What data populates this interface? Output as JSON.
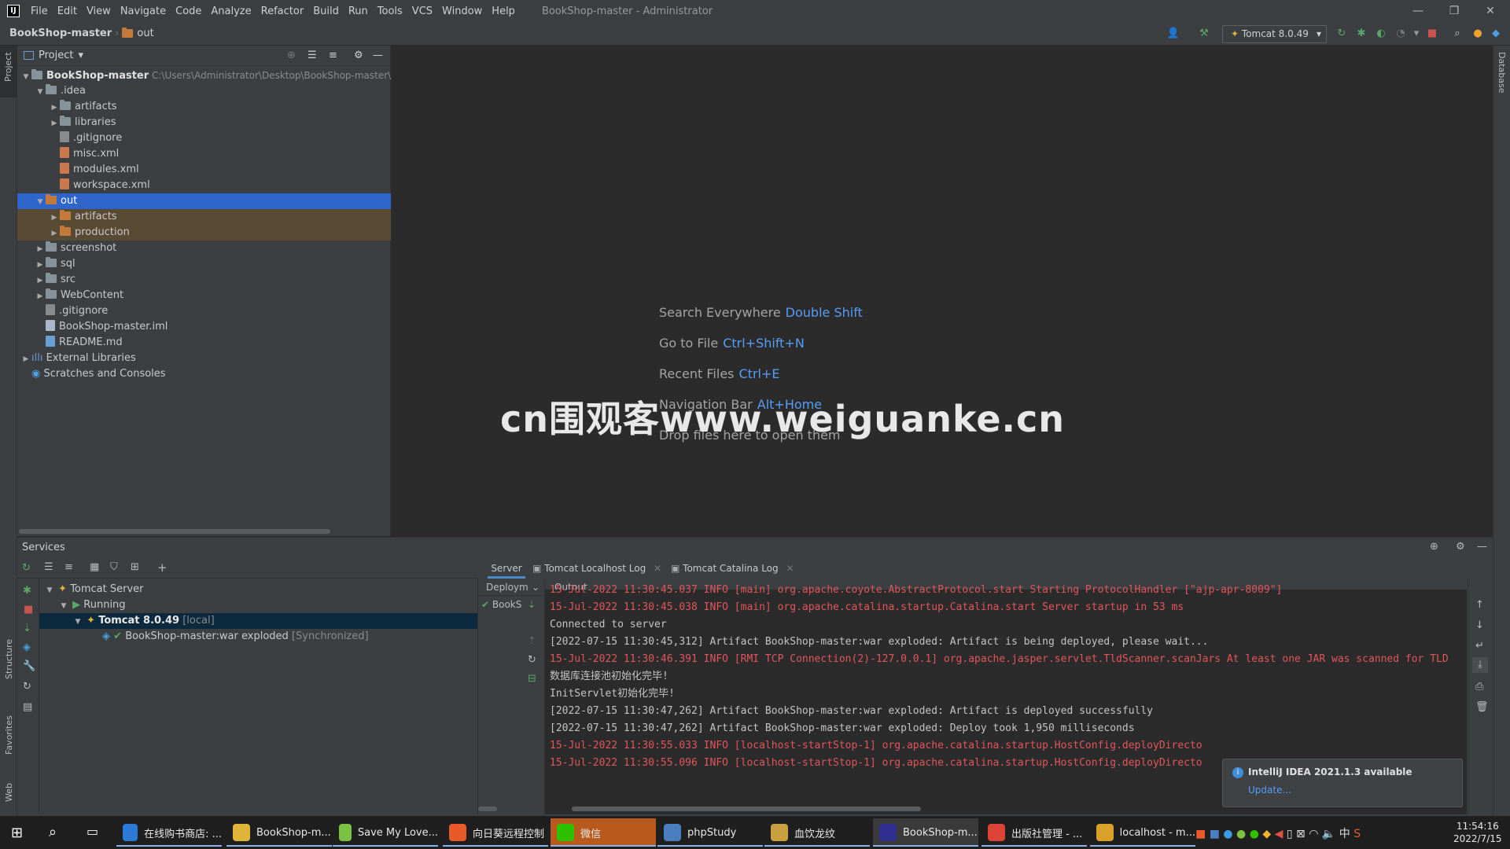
{
  "menubar": {
    "items": [
      "File",
      "Edit",
      "View",
      "Navigate",
      "Code",
      "Analyze",
      "Refactor",
      "Build",
      "Run",
      "Tools",
      "VCS",
      "Window",
      "Help"
    ],
    "title": "BookShop-master - Administrator"
  },
  "navbar": {
    "project": "BookShop-master",
    "folder": "out"
  },
  "toolbar": {
    "run_config": "Tomcat 8.0.49"
  },
  "side_labels": {
    "project": "Project",
    "structure": "Structure",
    "favorites": "Favorites",
    "web": "Web",
    "database": "Database"
  },
  "project_panel": {
    "title": "Project",
    "tree": [
      {
        "label": "BookShop-master",
        "path": "C:\\Users\\Administrator\\Desktop\\BookShop-master\\Bo",
        "indent": 0,
        "expanded": true,
        "type": "module"
      },
      {
        "label": ".idea",
        "indent": 1,
        "expanded": true,
        "type": "folder"
      },
      {
        "label": "artifacts",
        "indent": 2,
        "expanded": false,
        "type": "folder"
      },
      {
        "label": "libraries",
        "indent": 2,
        "expanded": false,
        "type": "folder"
      },
      {
        "label": ".gitignore",
        "indent": 2,
        "type": "git"
      },
      {
        "label": "misc.xml",
        "indent": 2,
        "type": "xml"
      },
      {
        "label": "modules.xml",
        "indent": 2,
        "type": "xml"
      },
      {
        "label": "workspace.xml",
        "indent": 2,
        "type": "xml"
      },
      {
        "label": "out",
        "indent": 1,
        "expanded": true,
        "type": "folder-orange",
        "selected": true
      },
      {
        "label": "artifacts",
        "indent": 2,
        "expanded": false,
        "type": "folder-orange",
        "highlight": true
      },
      {
        "label": "production",
        "indent": 2,
        "expanded": false,
        "type": "folder-orange",
        "highlight": true
      },
      {
        "label": "screenshot",
        "indent": 1,
        "expanded": false,
        "type": "folder"
      },
      {
        "label": "sql",
        "indent": 1,
        "expanded": false,
        "type": "folder"
      },
      {
        "label": "src",
        "indent": 1,
        "expanded": false,
        "type": "folder"
      },
      {
        "label": "WebContent",
        "indent": 1,
        "expanded": false,
        "type": "folder"
      },
      {
        "label": ".gitignore",
        "indent": 1,
        "type": "git"
      },
      {
        "label": "BookShop-master.iml",
        "indent": 1,
        "type": "file"
      },
      {
        "label": "README.md",
        "indent": 1,
        "type": "md"
      },
      {
        "label": "External Libraries",
        "indent": 0,
        "expanded": false,
        "type": "lib"
      },
      {
        "label": "Scratches and Consoles",
        "indent": 0,
        "type": "scratch"
      }
    ]
  },
  "editor_hints": [
    {
      "label": "Search Everywhere",
      "key": "Double Shift"
    },
    {
      "label": "Go to File",
      "key": "Ctrl+Shift+N"
    },
    {
      "label": "Recent Files",
      "key": "Ctrl+E"
    },
    {
      "label": "Navigation Bar",
      "key": "Alt+Home"
    },
    {
      "label": "Drop files here to open them",
      "key": ""
    }
  ],
  "watermark": "cn围观客www.weiguanke.cn",
  "services": {
    "title": "Services",
    "tree": [
      {
        "label": "Tomcat Server",
        "extra": ""
      },
      {
        "label": "Running",
        "extra": ""
      },
      {
        "label": "Tomcat 8.0.49",
        "extra": "[local]"
      },
      {
        "label": "BookShop-master:war exploded",
        "extra": "[Synchronized]"
      }
    ],
    "tabs": {
      "server": "Server",
      "localhost_log": "Tomcat Localhost Log",
      "catalina_log": "Tomcat Catalina Log"
    },
    "deploy_header": "Deploym",
    "deploy_item": "BookS",
    "output_header": "Output",
    "log_lines": [
      {
        "text": "15-Jul-2022 11:30:45.037 INFO [main] org.apache.coyote.AbstractProtocol.start Starting ProtocolHandler [\"ajp-apr-8009\"]",
        "level": "red"
      },
      {
        "text": "15-Jul-2022 11:30:45.038 INFO [main] org.apache.catalina.startup.Catalina.start Server startup in 53 ms",
        "level": "red"
      },
      {
        "text": "Connected to server",
        "level": "norm"
      },
      {
        "text": "[2022-07-15 11:30:45,312] Artifact BookShop-master:war exploded: Artifact is being deployed, please wait...",
        "level": "norm"
      },
      {
        "text": "15-Jul-2022 11:30:46.391 INFO [RMI TCP Connection(2)-127.0.0.1] org.apache.jasper.servlet.TldScanner.scanJars At least one JAR was scanned for TLD",
        "level": "red"
      },
      {
        "text": "数据库连接池初始化完毕!",
        "level": "norm"
      },
      {
        "text": "InitServlet初始化完毕!",
        "level": "norm"
      },
      {
        "text": "[2022-07-15 11:30:47,262] Artifact BookShop-master:war exploded: Artifact is deployed successfully",
        "level": "norm"
      },
      {
        "text": "[2022-07-15 11:30:47,262] Artifact BookShop-master:war exploded: Deploy took 1,950 milliseconds",
        "level": "norm"
      },
      {
        "text": "15-Jul-2022 11:30:55.033 INFO [localhost-startStop-1] org.apache.catalina.startup.HostConfig.deployDirecto",
        "level": "red"
      },
      {
        "text": "15-Jul-2022 11:30:55.096 INFO [localhost-startStop-1] org.apache.catalina.startup.HostConfig.deployDirecto",
        "level": "red"
      }
    ]
  },
  "notification": {
    "title": "IntelliJ IDEA 2021.1.3 available",
    "link": "Update..."
  },
  "taskbar": {
    "items": [
      {
        "label": "在线购书商店: ...",
        "color": "#2b7bd6"
      },
      {
        "label": "BookShop-m...",
        "color": "#e0b43a"
      },
      {
        "label": "Save My Love...",
        "color": "#7cc242"
      },
      {
        "label": "向日葵远程控制",
        "color": "#e85a2a"
      },
      {
        "label": "微信",
        "color": "#2dc100"
      },
      {
        "label": "phpStudy",
        "color": "#4a7ebf"
      },
      {
        "label": "血饮龙纹",
        "color": "#c8a040"
      },
      {
        "label": "BookShop-m...",
        "color": "#2f2f8f"
      },
      {
        "label": "出版社管理 - ...",
        "color": "#db4437"
      },
      {
        "label": "localhost - m...",
        "color": "#d9a02a"
      }
    ],
    "time": "11:54:16",
    "date": "2022/7/15",
    "ime": "中"
  },
  "colors": {
    "accent": "#2f65ca",
    "link": "#589df6",
    "log_red": "#e0565b"
  }
}
